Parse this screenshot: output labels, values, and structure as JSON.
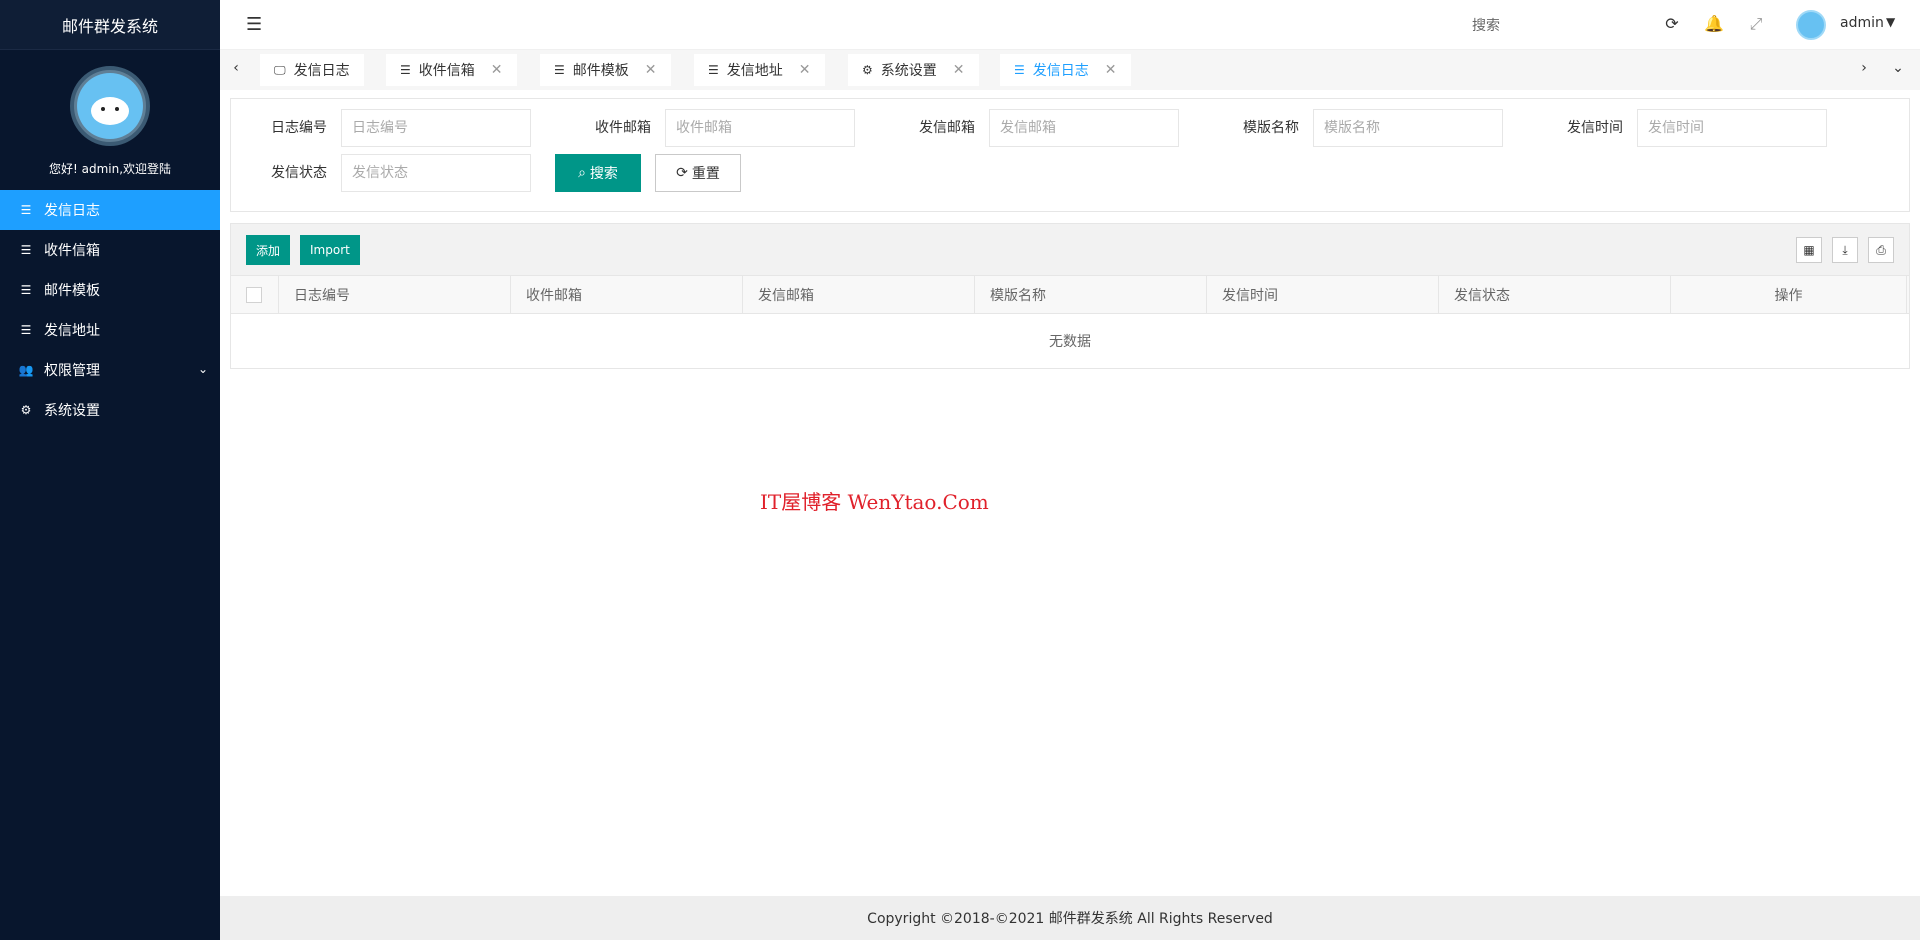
{
  "sidebar": {
    "brand": "邮件群发系统",
    "welcome": "您好! admin,欢迎登陆",
    "items": [
      {
        "label": "发信日志",
        "icon": "list-icon",
        "active": true
      },
      {
        "label": "收件信箱",
        "icon": "list-icon"
      },
      {
        "label": "邮件模板",
        "icon": "list-icon"
      },
      {
        "label": "发信地址",
        "icon": "list-icon"
      },
      {
        "label": "权限管理",
        "icon": "users-icon",
        "has_children": true
      },
      {
        "label": "系统设置",
        "icon": "gear-icon"
      }
    ]
  },
  "header": {
    "search": "搜索",
    "user": "admin"
  },
  "tabs": [
    {
      "label": "发信日志",
      "icon": "monitor-icon",
      "closable": false
    },
    {
      "label": "收件信箱",
      "icon": "list-icon",
      "closable": true
    },
    {
      "label": "邮件模板",
      "icon": "list-icon",
      "closable": true
    },
    {
      "label": "发信地址",
      "icon": "list-icon",
      "closable": true
    },
    {
      "label": "系统设置",
      "icon": "gear-icon",
      "closable": true
    },
    {
      "label": "发信日志",
      "icon": "list-icon",
      "closable": true,
      "active": true
    }
  ],
  "search_form": {
    "fields": [
      {
        "label": "日志编号",
        "placeholder": "日志编号"
      },
      {
        "label": "收件邮箱",
        "placeholder": "收件邮箱"
      },
      {
        "label": "发信邮箱",
        "placeholder": "发信邮箱"
      },
      {
        "label": "模版名称",
        "placeholder": "模版名称"
      },
      {
        "label": "发信时间",
        "placeholder": "发信时间"
      },
      {
        "label": "发信状态",
        "placeholder": "发信状态"
      }
    ],
    "search_label": "搜索",
    "reset_label": "重置"
  },
  "table": {
    "add_label": "添加",
    "import_label": "Import",
    "columns": [
      "日志编号",
      "收件邮箱",
      "发信邮箱",
      "模版名称",
      "发信时间",
      "发信状态",
      "操作"
    ],
    "empty_text": "无数据"
  },
  "watermark": "IT屋博客 WenYtao.Com",
  "footer": "Copyright ©2018-©2021 邮件群发系统 All Rights Reserved",
  "colors": {
    "sidebar_bg": "#08162d",
    "active_blue": "#1e9fff",
    "primary_green": "#009688",
    "watermark_red": "#e0212b"
  }
}
